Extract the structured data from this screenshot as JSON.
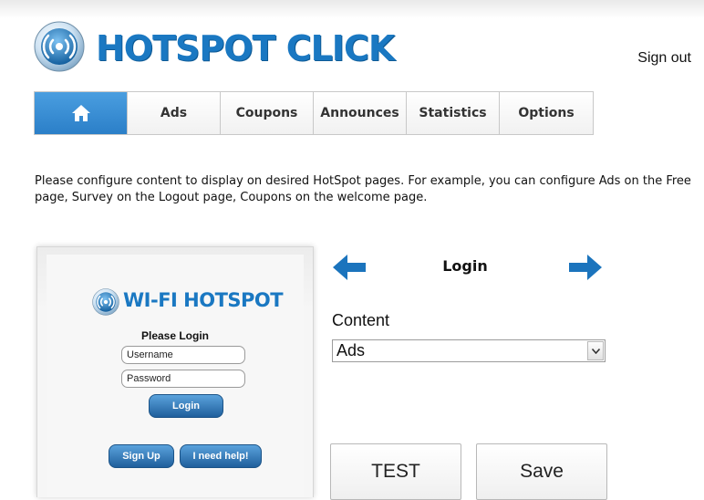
{
  "header": {
    "logo_text": "HOTSPOT CLICK",
    "sign_out": "Sign out"
  },
  "tabs": [
    {
      "label": "",
      "icon": "home-icon"
    },
    {
      "label": "Ads"
    },
    {
      "label": "Coupons"
    },
    {
      "label": "Announces"
    },
    {
      "label": "Statistics"
    },
    {
      "label": "Options"
    }
  ],
  "intro_text": "Please configure content to display on desired HotSpot pages. For example, you can configure Ads on the Free page, Survey on the Logout page, Coupons on the welcome page.",
  "preview": {
    "logo_text": "WI-FI HOTSPOT",
    "title": "Please Login",
    "username_placeholder": "Username",
    "password_placeholder": "Password",
    "login_button": "Login",
    "signup_button": "Sign Up",
    "help_button": "I need help!"
  },
  "page_selector": {
    "current_page": "Login",
    "prev_icon": "arrow-left-icon",
    "next_icon": "arrow-right-icon"
  },
  "content": {
    "label": "Content",
    "selected": "Ads"
  },
  "actions": {
    "test_label": "TEST",
    "save_label": "Save"
  },
  "colors": {
    "brand_blue": "#1a78c2",
    "tab_active": "#2b7fc8",
    "arrow_blue": "#1b74bd"
  }
}
